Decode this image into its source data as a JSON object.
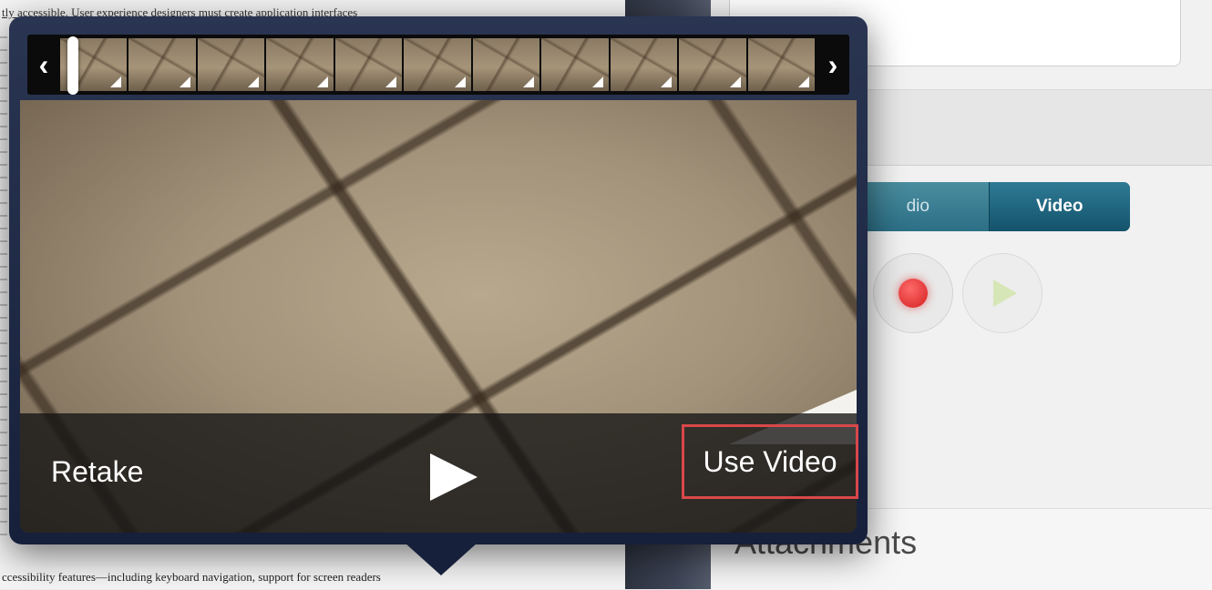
{
  "background_doc": {
    "top_text": "tly accessible. User experience designers must create application interfaces",
    "bottom_text": "ccessibility features—including keyboard navigation, support for screen readers"
  },
  "recorder": {
    "segment": {
      "audio_label": "dio",
      "video_label": "Video"
    },
    "record_icon": "record-icon",
    "play_icon": "play-icon"
  },
  "attachments": {
    "title": "Attachments"
  },
  "popover": {
    "filmstrip": {
      "left_arrow": "‹",
      "right_arrow": "›",
      "frame_count": 11
    },
    "retake_label": "Retake",
    "use_video_label": "Use Video",
    "play_icon": "play-icon",
    "colors": {
      "highlight_border": "#d9474a",
      "popover_bg": "#1c2642",
      "segment_active": "#14536b"
    }
  }
}
